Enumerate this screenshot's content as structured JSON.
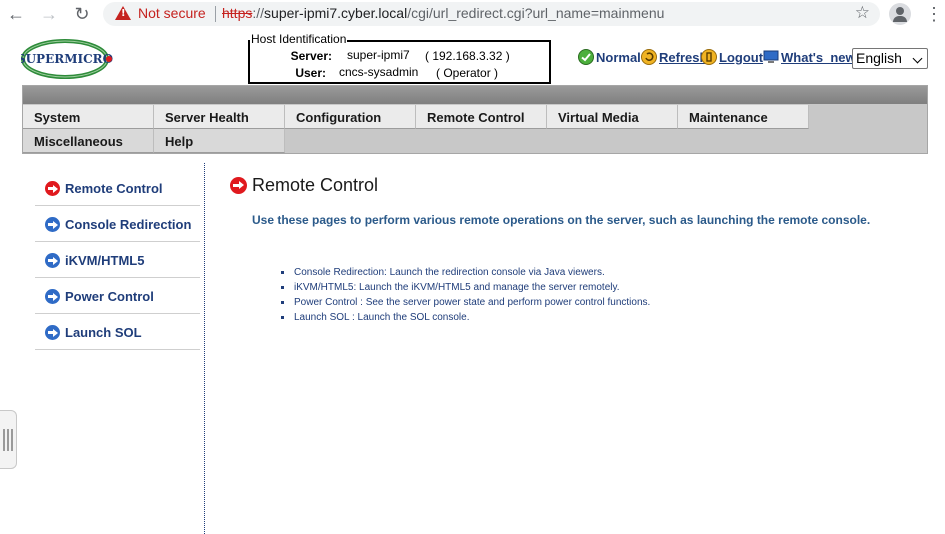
{
  "browser": {
    "security_label": "Not secure",
    "url_scheme": "https",
    "url_sep": "://",
    "url_host": "super-ipmi7.cyber.local",
    "url_path": "/cgi/url_redirect.cgi?url_name=mainmenu"
  },
  "logo": {
    "text": "SUPERMICRO"
  },
  "host_identification": {
    "title": "Host Identification",
    "server_label": "Server:",
    "server_name": "super-ipmi7",
    "server_ip": "( 192.168.3.32 )",
    "user_label": "User:",
    "user_name": "cncs-sysadmin",
    "user_role": "( Operator )"
  },
  "status_bar": {
    "normal": "Normal",
    "refresh": "Refresh",
    "logout": "Logout",
    "whats_new": "What's_new",
    "language": "English"
  },
  "menu": {
    "row1": [
      "System",
      "Server Health",
      "Configuration",
      "Remote Control",
      "Virtual Media",
      "Maintenance"
    ],
    "row2": [
      "Miscellaneous",
      "Help"
    ]
  },
  "sidebar": {
    "items": [
      {
        "label": "Remote Control",
        "active": true
      },
      {
        "label": "Console Redirection",
        "active": false
      },
      {
        "label": "iKVM/HTML5",
        "active": false
      },
      {
        "label": "Power Control",
        "active": false
      },
      {
        "label": "Launch SOL",
        "active": false
      }
    ]
  },
  "main": {
    "title": "Remote Control",
    "intro": "Use these pages to perform various remote operations on the server, such as launching the remote console.",
    "bullets": [
      "Console Redirection: Launch the redirection console via Java viewers.",
      "iKVM/HTML5: Launch the iKVM/HTML5 and manage the server remotely.",
      "Power Control : See the server power state and perform power control functions.",
      "Launch SOL : Launch the SOL console."
    ]
  },
  "colors": {
    "link_blue": "#1f3d7a",
    "intro_blue": "#2b5a8a",
    "active_arrow": "#e0191e",
    "inactive_arrow": "#2f6bc6",
    "chrome_warning": "#c5221f"
  }
}
